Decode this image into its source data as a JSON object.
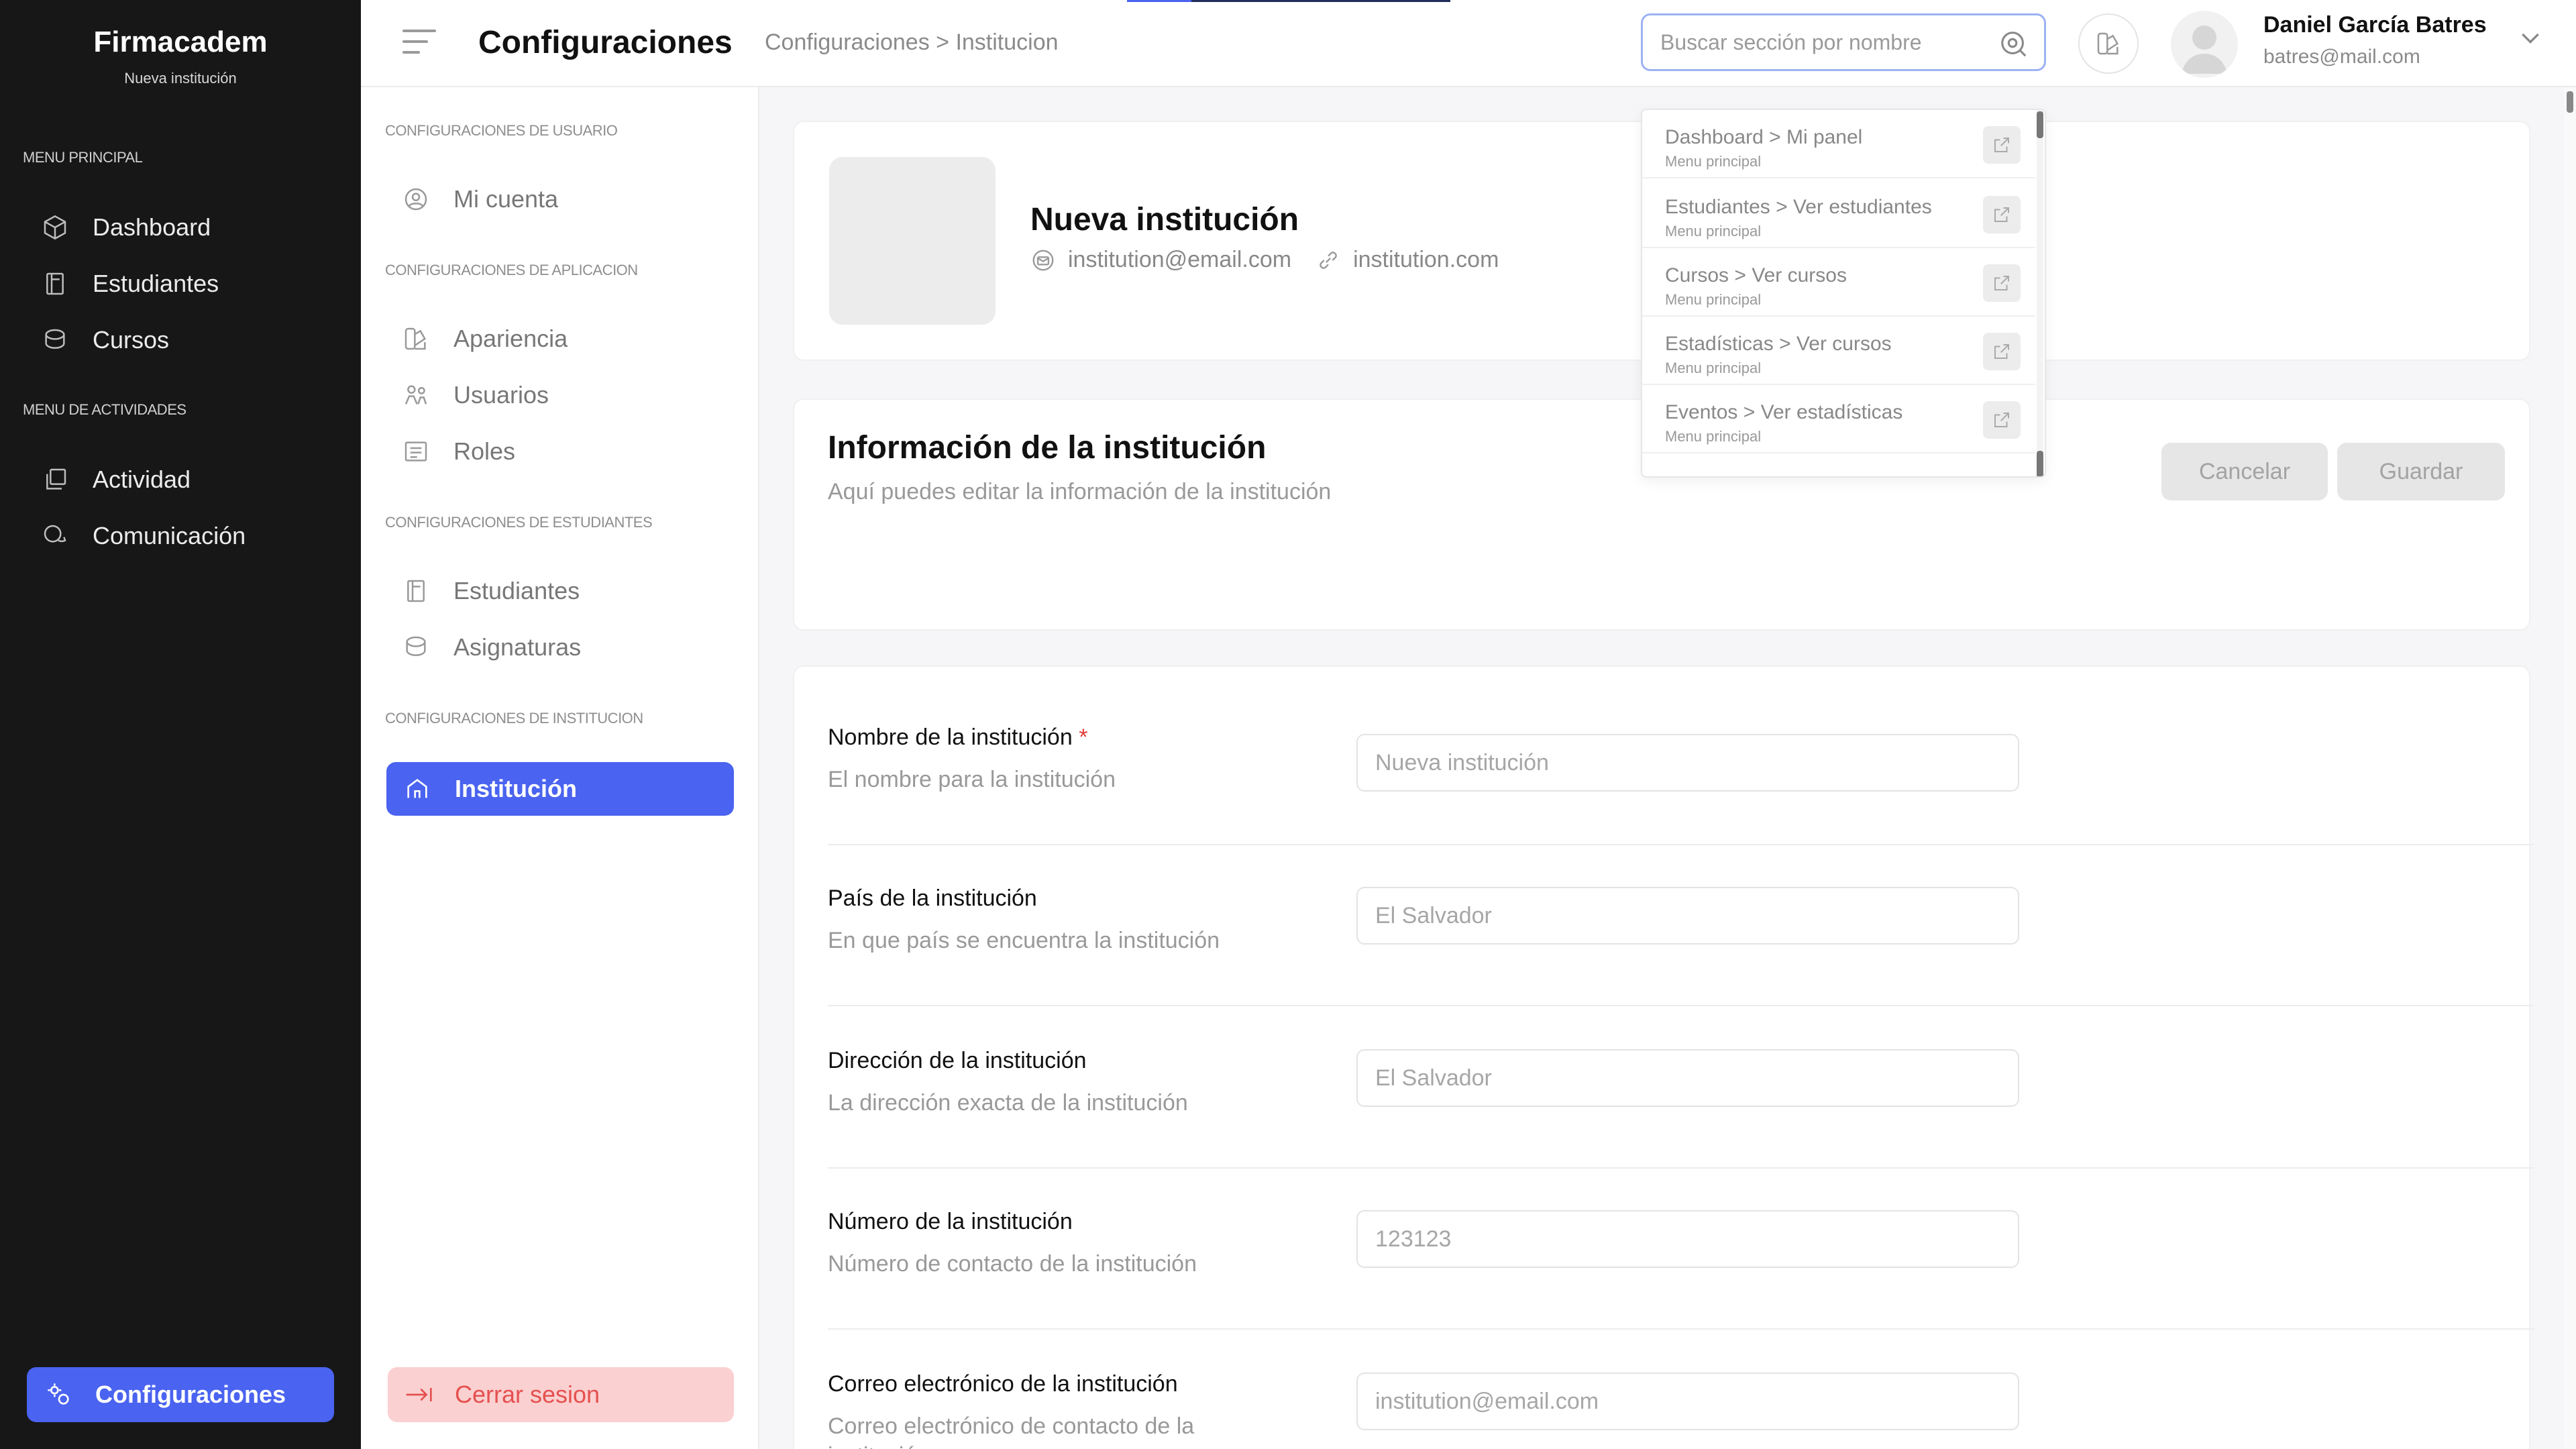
{
  "app": {
    "brand": "Firmacadem",
    "brand_sub": "Nueva institución"
  },
  "sidebar": {
    "sections": [
      {
        "title": "MENU PRINCIPAL",
        "items": [
          {
            "label": "Dashboard",
            "icon": "cube-icon"
          },
          {
            "label": "Estudiantes",
            "icon": "book-icon"
          },
          {
            "label": "Cursos",
            "icon": "database-icon"
          }
        ]
      },
      {
        "title": "MENU DE ACTIVIDADES",
        "items": [
          {
            "label": "Actividad",
            "icon": "copy-icon"
          },
          {
            "label": "Comunicación",
            "icon": "chat-icon"
          }
        ]
      }
    ],
    "footer_button": "Configuraciones"
  },
  "header": {
    "title": "Configuraciones",
    "breadcrumb": "Configuraciones > Institucion",
    "search_placeholder": "Buscar sección por nombre",
    "user": {
      "name": "Daniel García Batres",
      "email": "batres@mail.com"
    }
  },
  "settings_nav": {
    "sections": [
      {
        "title": "CONFIGURACIONES DE USUARIO",
        "items": [
          {
            "label": "Mi cuenta",
            "icon": "user-circle-icon"
          }
        ]
      },
      {
        "title": "CONFIGURACIONES DE APLICACION",
        "items": [
          {
            "label": "Apariencia",
            "icon": "palette-icon"
          },
          {
            "label": "Usuarios",
            "icon": "users-icon"
          },
          {
            "label": "Roles",
            "icon": "list-icon"
          }
        ]
      },
      {
        "title": "CONFIGURACIONES DE ESTUDIANTES",
        "items": [
          {
            "label": "Estudiantes",
            "icon": "book-icon"
          },
          {
            "label": "Asignaturas",
            "icon": "database-icon"
          }
        ]
      },
      {
        "title": "CONFIGURACIONES DE INSTITUCION",
        "items": []
      }
    ],
    "active": "Institución",
    "logout": "Cerrar sesion"
  },
  "institution": {
    "name": "Nueva institución",
    "email": "institution@email.com",
    "website": "institution.com"
  },
  "info_card": {
    "title": "Información de la institución",
    "subtitle": "Aquí puedes editar la información de la institución",
    "cancel": "Cancelar",
    "save": "Guardar"
  },
  "form": [
    {
      "label": "Nombre de la institución",
      "required": "*",
      "help": "El nombre para la institución",
      "value": "Nueva institución"
    },
    {
      "label": "País de la institución",
      "required": "",
      "help": "En que país se encuentra la institución",
      "value": "El Salvador"
    },
    {
      "label": "Dirección de la institución",
      "required": "",
      "help": "La dirección exacta de la institución",
      "value": "El Salvador"
    },
    {
      "label": "Número de la institución",
      "required": "",
      "help": "Número de contacto de la institución",
      "value": "123123"
    },
    {
      "label": "Correo electrónico de la institución",
      "required": "",
      "help": "Correo electrónico de contacto de la institución",
      "value": "institution@email.com"
    }
  ],
  "search_results": [
    {
      "title": "Dashboard > Mi panel",
      "sub": "Menu principal"
    },
    {
      "title": "Estudiantes > Ver estudiantes",
      "sub": "Menu principal"
    },
    {
      "title": "Cursos > Ver cursos",
      "sub": "Menu principal"
    },
    {
      "title": "Estadísticas > Ver cursos",
      "sub": "Menu principal"
    },
    {
      "title": "Eventos > Ver estadísticas",
      "sub": "Menu principal"
    }
  ],
  "colors": {
    "accent": "#4a63f0",
    "sidebar_bg": "#171717",
    "danger_bg": "#fbd0d0",
    "danger_text": "#e4504f"
  }
}
